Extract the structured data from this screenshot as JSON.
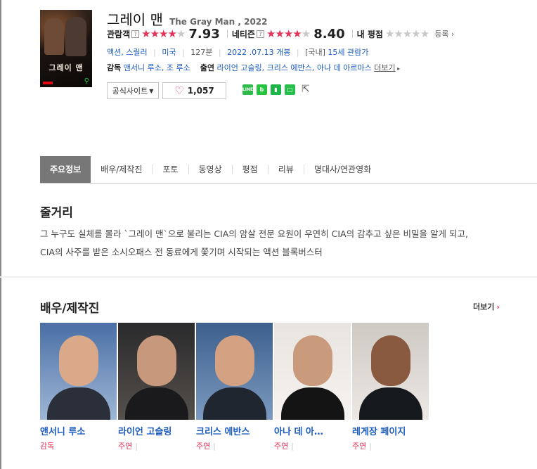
{
  "movie": {
    "title_ko": "그레이 맨",
    "title_en": "The Gray Man , 2022",
    "poster_text": "그레이 맨"
  },
  "ratings": {
    "audience_label": "관람객",
    "audience_score": "7.93",
    "audience_stars": 4,
    "netizen_label": "네티즌",
    "netizen_score": "8.40",
    "netizen_stars": 4,
    "my_label": "내 평점",
    "my_stars": 0,
    "register_label": "등록",
    "help_glyph": "?"
  },
  "info": {
    "genre": "액션, 스릴러",
    "country": "미국",
    "runtime": "127분",
    "release": "2022 .07.13 개봉",
    "rating_prefix": "[국내]",
    "rating": "15세 관람가",
    "director_label": "감독",
    "directors": "앤서니 루소, 조 루소",
    "cast_label": "출연",
    "cast": "라이언 고슬링, 크리스 에반스, 아나 데 아르마스",
    "more_label": "더보기"
  },
  "buttons": {
    "official_site": "공식사이트",
    "like_count": "1,057"
  },
  "share_icons": [
    "line-icon",
    "band-icon",
    "bookmark-icon",
    "blog-icon",
    "share-icon"
  ],
  "tabs": [
    {
      "label": "주요정보",
      "active": true
    },
    {
      "label": "배우/제작진"
    },
    {
      "label": "포토"
    },
    {
      "label": "동영상"
    },
    {
      "label": "평점"
    },
    {
      "label": "리뷰"
    },
    {
      "label": "명대사/연관영화"
    }
  ],
  "synopsis": {
    "title": "줄거리",
    "line1": "그 누구도 실체를 몰라 `그레이 맨`으로 불리는 CIA의 암살 전문 요원이 우연히 CIA의 감추고 싶은 비밀을 알게 되고,",
    "line2": "CIA의 사주를 받은 소시오패스 전 동료에게 쫓기며 시작되는 액션 블록버스터"
  },
  "cast_section": {
    "title": "배우/제작진",
    "more": "더보기",
    "people": [
      {
        "name": "앤서니 루소",
        "role": "감독"
      },
      {
        "name": "라이언 고슬링",
        "role": "주연"
      },
      {
        "name": "크리스 에반스",
        "role": "주연"
      },
      {
        "name": "아나 데 아…",
        "role": "주연"
      },
      {
        "name": "레게장 페이지",
        "role": "주연"
      }
    ]
  },
  "colors": {
    "accent_red": "#e0345a",
    "link_blue": "#1a5bbd",
    "active_tab": "#777777"
  }
}
